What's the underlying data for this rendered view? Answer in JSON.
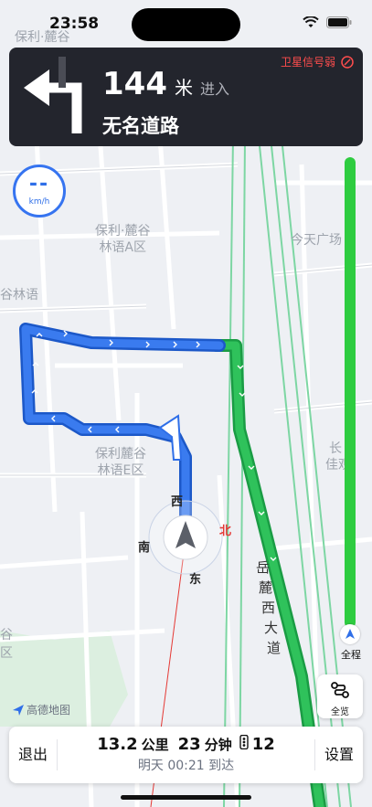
{
  "status_bar": {
    "time": "23:58"
  },
  "navigation": {
    "distance_value": "144",
    "distance_unit": "米",
    "action": "进入",
    "road_name": "无名道路",
    "gps_warning": "卫星信号弱"
  },
  "speedometer": {
    "value": "--",
    "unit": "km/h"
  },
  "map_labels": {
    "poi_1_line1": "保利·麓谷",
    "poi_1_line2": "林语A区",
    "poi_2_line1": "保利麓谷",
    "poi_2_line2": "林语E区",
    "poi_3": "今天广场",
    "poi_left_top": "保利·麓谷",
    "poi_left_mid": "谷林语",
    "poi_right_1": "长",
    "poi_right_2": "佳观",
    "poi_left_bottom_1": "谷",
    "poi_left_bottom_2": "区",
    "road_vertical": [
      "岳",
      "麓",
      "西",
      "大",
      "道"
    ]
  },
  "compass": {
    "north": "北",
    "south": "南",
    "east": "东",
    "west": "西"
  },
  "route_progress": {
    "label": "全程"
  },
  "overview_button": {
    "label": "全览"
  },
  "brand": {
    "text": "高德地图"
  },
  "bottom_bar": {
    "exit_label": "退出",
    "distance": "13.2",
    "distance_unit": "公里",
    "duration": "23",
    "duration_unit": "分钟",
    "traffic_lights": "12",
    "eta": "明天 00:21 到达",
    "settings_label": "设置"
  },
  "colors": {
    "route_blue": "#2f6fe8",
    "route_green": "#1fb34f",
    "nav_card_bg": "#23252d",
    "warning_red": "#ff4d4d"
  }
}
